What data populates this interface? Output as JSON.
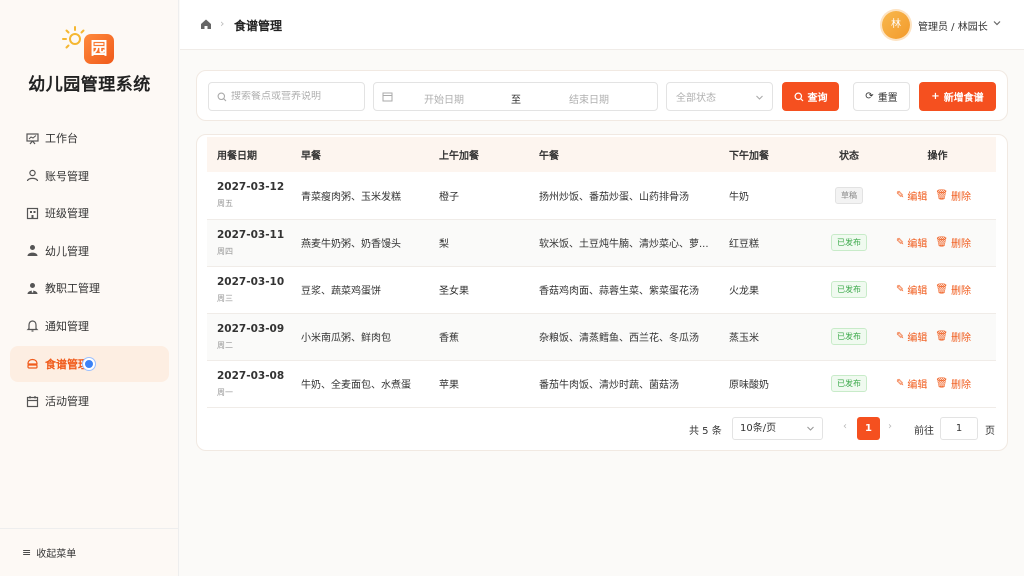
{
  "brand": {
    "title": "幼儿园管理系统",
    "badge_char": "园"
  },
  "sidebar": {
    "items": [
      {
        "label": "工作台",
        "icon": "dashboard-icon"
      },
      {
        "label": "账号管理",
        "icon": "user-icon"
      },
      {
        "label": "班级管理",
        "icon": "building-icon"
      },
      {
        "label": "幼儿管理",
        "icon": "child-icon"
      },
      {
        "label": "教职工管理",
        "icon": "staff-icon"
      },
      {
        "label": "通知管理",
        "icon": "bell-icon"
      },
      {
        "label": "食谱管理",
        "icon": "food-icon",
        "active": true
      },
      {
        "label": "活动管理",
        "icon": "calendar-icon"
      }
    ],
    "collapse_label": "收起菜单"
  },
  "header": {
    "page_title": "食谱管理",
    "avatar_char": "林",
    "user_name": "管理员 / 林园长"
  },
  "filters": {
    "search_placeholder": "搜索餐点或营养说明",
    "start_placeholder": "开始日期",
    "to_label": "至",
    "end_placeholder": "结束日期",
    "status_placeholder": "全部状态",
    "query_label": "查询",
    "reset_label": "重置",
    "add_label": "新增食谱"
  },
  "table": {
    "columns": [
      "用餐日期",
      "早餐",
      "上午加餐",
      "午餐",
      "下午加餐",
      "状态",
      "操作"
    ],
    "rows": [
      {
        "date": "2027-03-12",
        "weekday": "周五",
        "breakfast": "青菜瘦肉粥、玉米发糕",
        "morning_snack": "橙子",
        "lunch": "扬州炒饭、番茄炒蛋、山药排骨汤",
        "afternoon_snack": "牛奶",
        "status": "草稿",
        "status_type": "draft"
      },
      {
        "date": "2027-03-11",
        "weekday": "周四",
        "breakfast": "燕麦牛奶粥、奶香馒头",
        "morning_snack": "梨",
        "lunch": "软米饭、土豆炖牛腩、清炒菜心、萝...",
        "afternoon_snack": "红豆糕",
        "status": "已发布",
        "status_type": "published"
      },
      {
        "date": "2027-03-10",
        "weekday": "周三",
        "breakfast": "豆浆、蔬菜鸡蛋饼",
        "morning_snack": "圣女果",
        "lunch": "香菇鸡肉面、蒜蓉生菜、紫菜蛋花汤",
        "afternoon_snack": "火龙果",
        "status": "已发布",
        "status_type": "published"
      },
      {
        "date": "2027-03-09",
        "weekday": "周二",
        "breakfast": "小米南瓜粥、鲜肉包",
        "morning_snack": "香蕉",
        "lunch": "杂粮饭、清蒸鳕鱼、西兰花、冬瓜汤",
        "afternoon_snack": "蒸玉米",
        "status": "已发布",
        "status_type": "published"
      },
      {
        "date": "2027-03-08",
        "weekday": "周一",
        "breakfast": "牛奶、全麦面包、水煮蛋",
        "morning_snack": "苹果",
        "lunch": "番茄牛肉饭、清炒时蔬、菌菇汤",
        "afternoon_snack": "原味酸奶",
        "status": "已发布",
        "status_type": "published"
      }
    ],
    "edit_label": "编辑",
    "delete_label": "删除"
  },
  "pagination": {
    "total": "共 5 条",
    "page_size": "10条/页",
    "current_page": "1",
    "goto_label": "前往",
    "goto_value": "1",
    "page_unit": "页"
  },
  "colors": {
    "accent": "#f5501f",
    "published": "#3ba94a",
    "active_bg": "#fdeee2"
  }
}
